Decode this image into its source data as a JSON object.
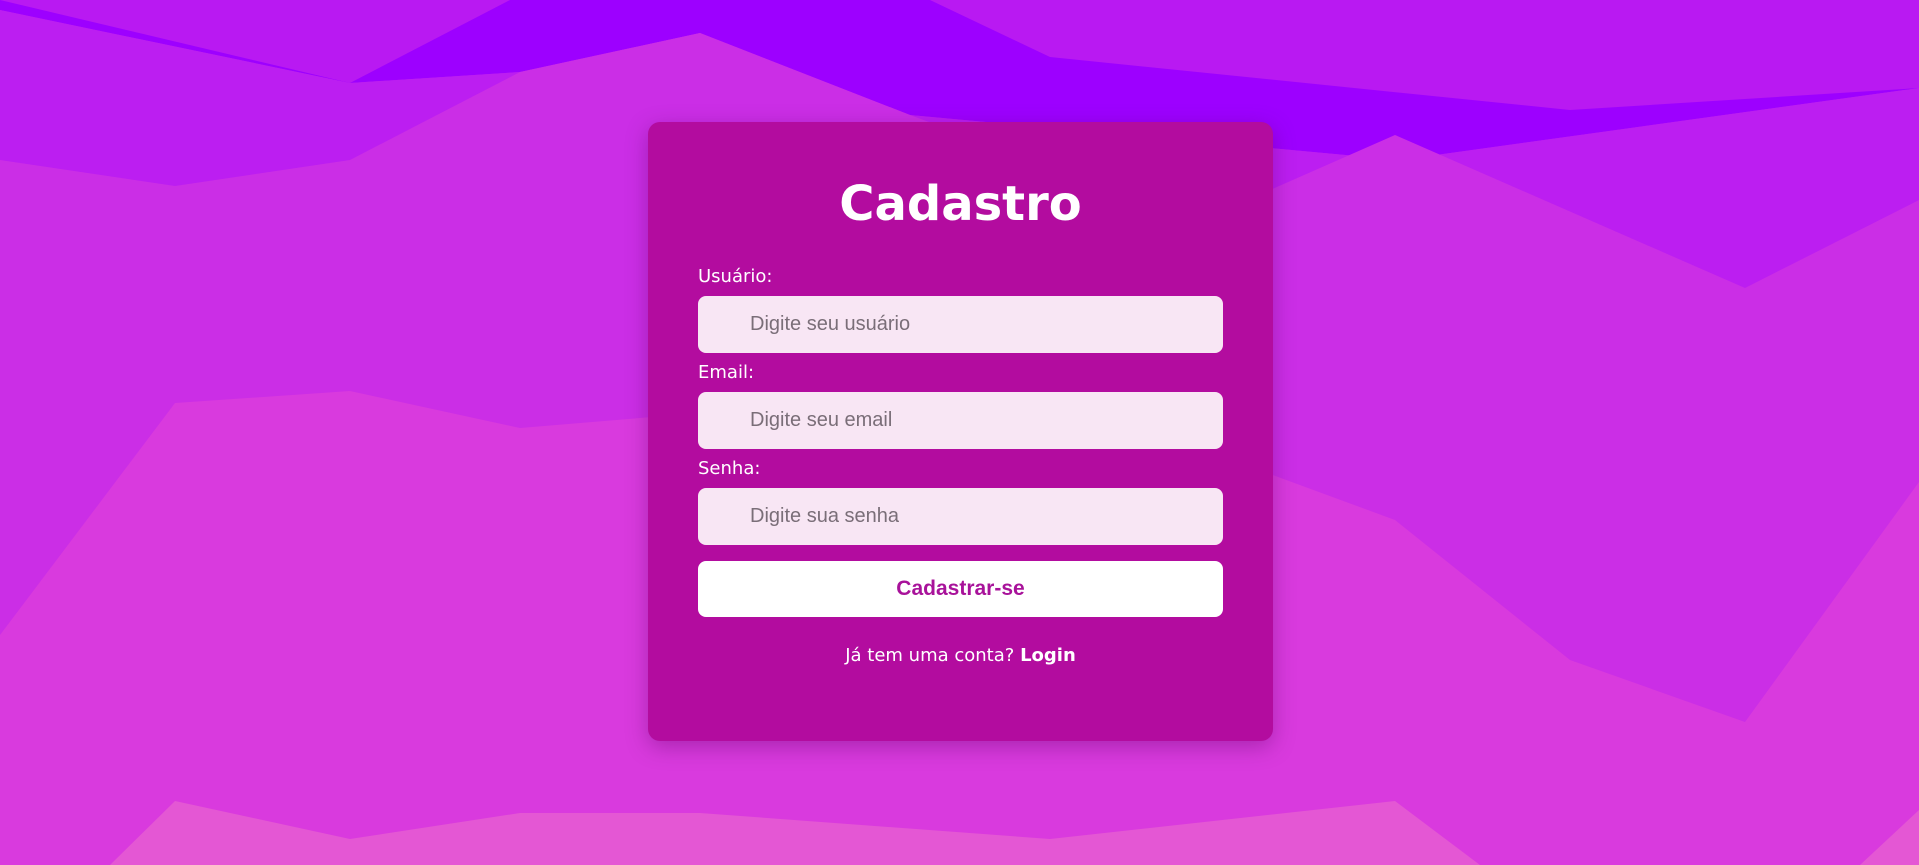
{
  "colors": {
    "background": "#9d00ff",
    "card": "#b30c9f",
    "input_background": "#f8e6f4",
    "button_background": "#ffffff",
    "button_text": "#a8129a"
  },
  "form": {
    "title": "Cadastro",
    "fields": [
      {
        "label": "Usuário:",
        "placeholder": "Digite seu usuário",
        "value": "",
        "icon": "user-icon"
      },
      {
        "label": "Email:",
        "placeholder": "Digite seu email",
        "value": "",
        "icon": "email-icon"
      },
      {
        "label": "Senha:",
        "placeholder": "Digite sua senha",
        "value": "",
        "icon": "lock-icon"
      }
    ],
    "submit_label": "Cadastrar-se",
    "footer_text": "Já tem uma conta?",
    "login_link": "Login"
  }
}
